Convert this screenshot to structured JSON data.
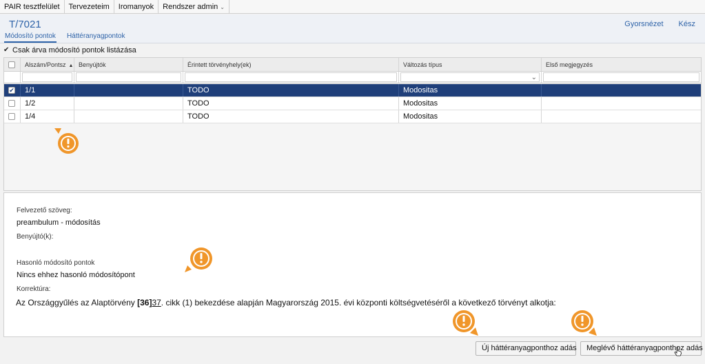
{
  "menubar": {
    "items": [
      {
        "label": "PAIR tesztfelület"
      },
      {
        "label": "Tervezeteim"
      },
      {
        "label": "Iromanyok"
      },
      {
        "label": "Rendszer admin"
      }
    ]
  },
  "header": {
    "title": "T/7021",
    "tabs": [
      {
        "label": "Módosító pontok",
        "active": true
      },
      {
        "label": "Háttéranyagpontok",
        "active": false
      }
    ],
    "links": {
      "quick_view": "Gyorsnézet",
      "done": "Kész"
    }
  },
  "filter": {
    "label": "Csak árva módosító pontok listázása",
    "checked": true
  },
  "grid": {
    "columns": [
      "Alszám/Pontsz",
      "Benyújtók",
      "Érintett törvényhely(ek)",
      "Változás típus",
      "Első megjegyzés"
    ],
    "rows": [
      {
        "num": "1/1",
        "benyujtok": "",
        "erintett": "TODO",
        "valtozas": "Modositas",
        "megjegyzes": "",
        "selected": true
      },
      {
        "num": "1/2",
        "benyujtok": "",
        "erintett": "TODO",
        "valtozas": "Modositas",
        "megjegyzes": "",
        "selected": false
      },
      {
        "num": "1/4",
        "benyujtok": "",
        "erintett": "TODO",
        "valtozas": "Modositas",
        "megjegyzes": "",
        "selected": false
      }
    ]
  },
  "detail": {
    "felvezeto_label": "Felvezető szöveg:",
    "felvezeto_value": "preambulum - módosítás",
    "benyujto_label": "Benyújtó(k):",
    "hasonlo_label": "Hasonló módosító pontok",
    "hasonlo_value": "Nincs ehhez hasonló módosítópont",
    "korrektura_label": "Korrektúra:",
    "korrektura_prefix": "Az Országgyűlés az Alaptörvény ",
    "korrektura_bold": "[36]",
    "korrektura_underline": "37",
    "korrektura_suffix": ". cikk (1) bekezdése alapján Magyarország 2015. évi központi költségvetéséről a következő törvényt alkotja:"
  },
  "buttons": {
    "new_background": "Új háttéranyagponthoz adás",
    "existing_background": "Meglévő háttéranyagponthoz adás"
  },
  "colors": {
    "accent": "#2e63a8",
    "selected_row": "#1f3f7a",
    "warning": "#f0962a"
  },
  "icons": {
    "warning": "warning-icon",
    "checkbox": "checkbox-icon",
    "chevron": "chevron-down-icon",
    "cursor": "hand-cursor-icon"
  }
}
